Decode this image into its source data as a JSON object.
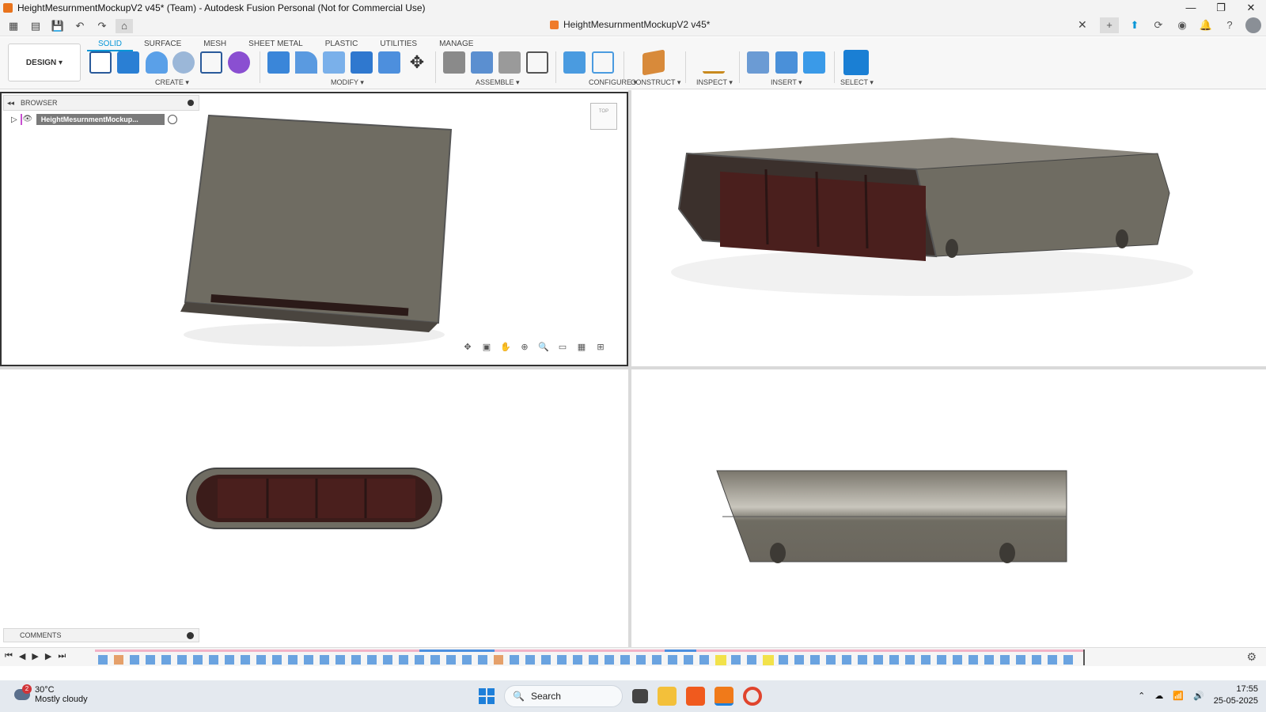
{
  "window": {
    "title": "HeightMesurnmentMockupV2 v45* (Team) - Autodesk Fusion Personal (Not for Commercial Use)",
    "minimize": "—",
    "maximize": "❐",
    "close": "✕"
  },
  "document_tab": {
    "name": "HeightMesurnmentMockupV2 v45*",
    "close": "✕"
  },
  "workspace": {
    "label": "DESIGN ▾"
  },
  "ribbon_tabs": [
    "SOLID",
    "SURFACE",
    "MESH",
    "SHEET METAL",
    "PLASTIC",
    "UTILITIES",
    "MANAGE"
  ],
  "ribbon_groups": {
    "create": "CREATE ▾",
    "modify": "MODIFY ▾",
    "assemble": "ASSEMBLE ▾",
    "configure": "CONFIGURE ▾",
    "construct": "CONSTRUCT ▾",
    "inspect": "INSPECT ▾",
    "insert": "INSERT ▾",
    "select": "SELECT ▾"
  },
  "browser": {
    "title": "BROWSER",
    "root_item": "HeightMesurnmentMockup..."
  },
  "comments": {
    "title": "COMMENTS"
  },
  "taskbar": {
    "temperature": "30°C",
    "weather": "Mostly cloudy",
    "weather_badge": "2",
    "search": "Search",
    "time": "17:55",
    "date": "25-05-2025"
  },
  "colors": {
    "accent": "#0696d7",
    "model_gray": "#6f6c62",
    "model_dark": "#3a2f2c",
    "grille": "#4a1f1d"
  }
}
